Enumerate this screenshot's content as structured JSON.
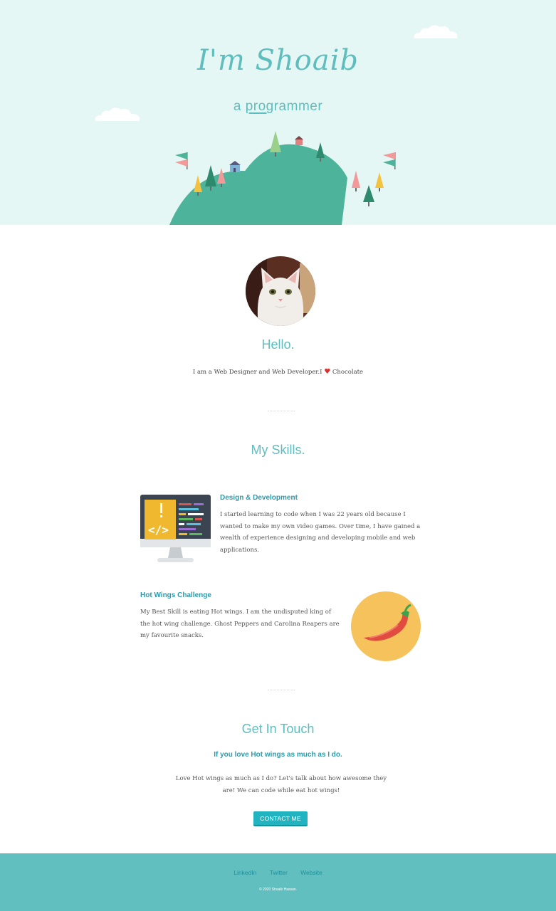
{
  "hero": {
    "title": "I'm Shoaib",
    "subtitle_prefix": "a ",
    "subtitle_underlined": "prog",
    "subtitle_suffix": "rammer"
  },
  "about": {
    "heading": "Hello.",
    "text_before_heart": "I am a Web Designer and Web Developer.I ",
    "heart": "♥",
    "text_after_heart": " Chocolate"
  },
  "skills": {
    "heading": "My Skills.",
    "items": [
      {
        "title": "Design & Development",
        "text": "I started learning to code when I was 22 years old because I wanted to make my own video games. Over time, I have gained a wealth of experience designing and developing mobile and web applications.",
        "icon": "computer-code-icon"
      },
      {
        "title": "Hot Wings Challenge",
        "text": "My Best Skill is eating Hot wings. I am the undisputed king of the hot wing challenge. Ghost Peppers and Carolina Reapers are my favourite snacks.",
        "icon": "chili-pepper-icon"
      }
    ]
  },
  "contact": {
    "heading": "Get In Touch",
    "subheading": "If you love Hot wings as much as I do.",
    "text": "Love Hot wings as much as I do? Let's talk about how awesome they are! We can code while eat hot wings!",
    "button_label": "CONTACT ME"
  },
  "footer": {
    "links": [
      "LinkedIn",
      "Twitter",
      "Website"
    ],
    "copyright": "© 2020 Shoaib Hassan."
  },
  "colors": {
    "accent": "#5fbdbd",
    "hero_bg": "#e5f7f4",
    "hill": "#4db39a",
    "button": "#22b3c1",
    "footer_bg": "#62bfbf"
  }
}
